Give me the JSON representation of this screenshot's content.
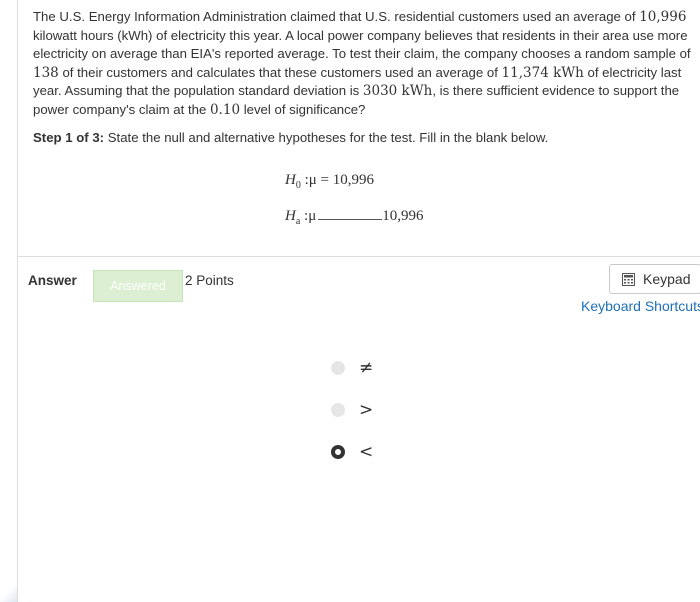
{
  "question": {
    "p1": "The U.S. Energy Information Administration claimed that U.S. residential customers used an average of ",
    "v1": "10,996",
    "p2": " kilowatt hours (kWh) of electricity this year. A local power company believes that residents in their area use more electricity on average than EIA's reported average. To test their claim, the company chooses a random sample of ",
    "v2": "138",
    "p3": " of their customers and calculates that these customers used an average of ",
    "v3": "11,374 kWh",
    "p4": " of electricity last year. Assuming that the population standard deviation is ",
    "v4": "3030 kWh",
    "p5": ", is there sufficient evidence to support the power company's claim at the ",
    "v5": "0.10",
    "p6": " level of significance?"
  },
  "step": {
    "label": "Step 1 of 3:",
    "text": " State the null and alternative hypotheses for the test. Fill in the blank below."
  },
  "hypotheses": {
    "h0_symbol": "H",
    "h0_sub": "0",
    "h0_rel": " :μ = 10,996",
    "ha_symbol": "H",
    "ha_sub": "a",
    "ha_rel": " :μ",
    "ha_value": "10,996"
  },
  "answer": {
    "label": "Answer",
    "status": "Answered",
    "points": "2 Points",
    "keypad": "Keypad",
    "shortcuts": "Keyboard Shortcuts"
  },
  "options": [
    {
      "label": "≠",
      "selected": false
    },
    {
      "label": ">",
      "selected": false
    },
    {
      "label": "<",
      "selected": true
    }
  ]
}
